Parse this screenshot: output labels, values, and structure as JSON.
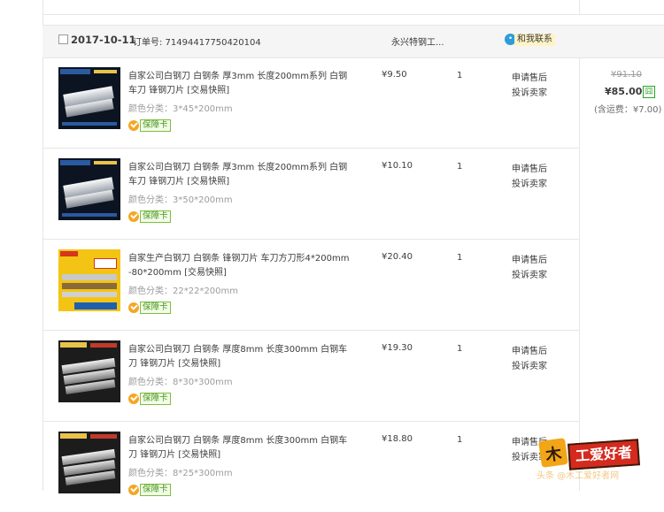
{
  "order": {
    "date": "2017-10-11",
    "order_no": "订单号: 71494417750420104",
    "shop": "永兴特钢工...",
    "contact_label": "和我联系",
    "contact_icon": "chat-bubble-icon"
  },
  "items": [
    {
      "title": "自家公司白钢刀 白钢条 厚3mm 长度200mm系列 白钢车刀 锋钢刀片 [交易快照]",
      "spec": "颜色分类：3*45*200mm",
      "guarantee": "保障卡",
      "price": "¥9.50",
      "qty": "1",
      "action1": "申请售后",
      "action2": "投诉卖家"
    },
    {
      "title": "自家公司白钢刀 白钢条 厚3mm 长度200mm系列 白钢车刀 锋钢刀片 [交易快照]",
      "spec": "颜色分类：3*50*200mm",
      "guarantee": "保障卡",
      "price": "¥10.10",
      "qty": "1",
      "action1": "申请售后",
      "action2": "投诉卖家"
    },
    {
      "title": "自家生产白钢刀 白钢条 锋钢刀片 车刀方刀形4*200mm -80*200mm [交易快照]",
      "spec": "颜色分类：22*22*200mm",
      "guarantee": "保障卡",
      "price": "¥20.40",
      "qty": "1",
      "action1": "申请售后",
      "action2": "投诉卖家"
    },
    {
      "title": "自家公司白钢刀 白钢条 厚度8mm 长度300mm 白钢车刀 锋钢刀片 [交易快照]",
      "spec": "颜色分类：8*30*300mm",
      "guarantee": "保障卡",
      "price": "¥19.30",
      "qty": "1",
      "action1": "申请售后",
      "action2": "投诉卖家"
    },
    {
      "title": "自家公司白钢刀 白钢条 厚度8mm 长度300mm 白钢车刀 锋钢刀片 [交易快照]",
      "spec": "颜色分类：8*25*300mm",
      "guarantee": "保障卡",
      "price": "¥18.80",
      "qty": "1",
      "action1": "申请售后",
      "action2": "投诉卖家"
    }
  ],
  "summary": {
    "original_total": "¥91.10",
    "total": "¥85.00",
    "pay_badge": "囧",
    "shipping": "(含运费：¥7.00)"
  },
  "watermark": {
    "logo_char": "木",
    "logo_text": "工爱好者",
    "sub": "头条 @木工爱好者网"
  },
  "colors": {
    "accent_blue": "#2e9cdc",
    "guarantee_green": "#4a9a1e",
    "logo_red": "#d42b1e"
  }
}
